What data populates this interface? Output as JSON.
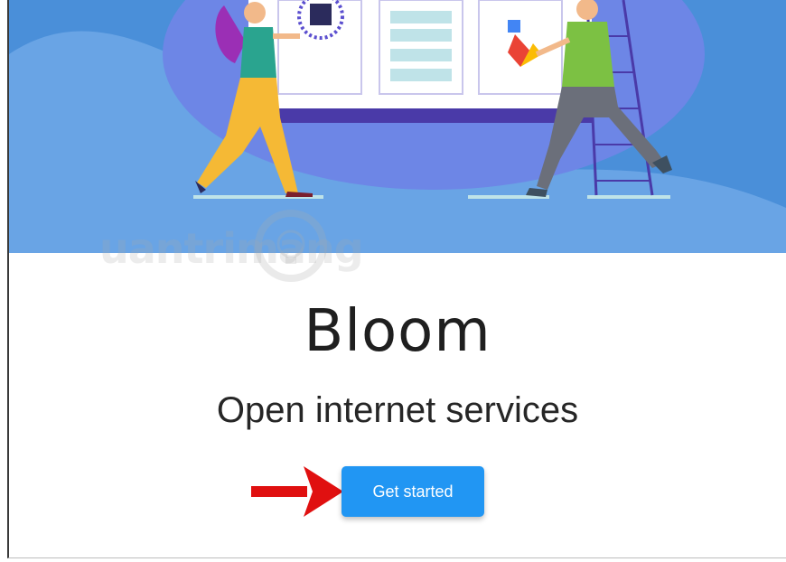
{
  "hero": {
    "illustration": "people-building-website-illustration",
    "colors": {
      "sky": "#4a8fd9",
      "blob": "#6d86e6",
      "screen_bar": "#4a3aa8"
    }
  },
  "watermark": {
    "text": "uantrimang"
  },
  "main": {
    "title": "Bloom",
    "tagline": "Open internet services",
    "cta_label": "Get started"
  },
  "annotation": {
    "arrow_color": "#e01010",
    "icon": "red-arrow-icon"
  },
  "colors": {
    "accent": "#2196f3"
  }
}
